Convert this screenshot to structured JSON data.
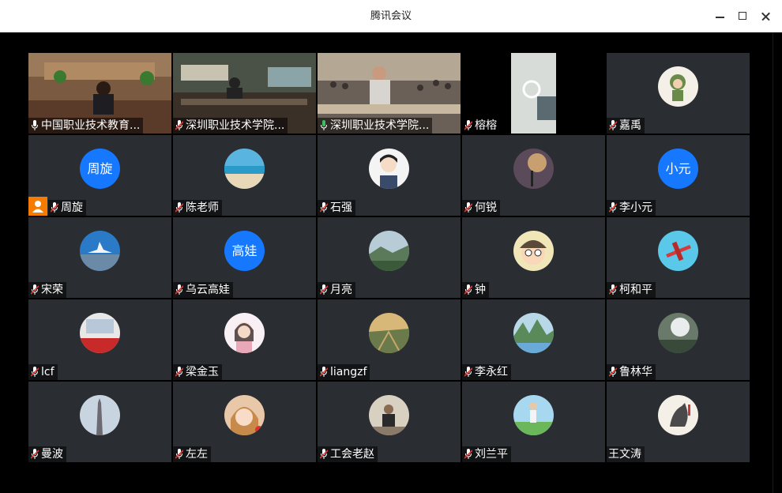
{
  "window": {
    "title": "腾讯会议"
  },
  "colors": {
    "accent": "#1677ff",
    "tile_bg": "#2a2d32",
    "active_border": "#3bbf5c",
    "host_badge": "#f57c00"
  },
  "participants": [
    {
      "name": "中国职业技术教育...",
      "mic": "on-white"
    },
    {
      "name": "深圳职业技术学院...",
      "mic": "muted"
    },
    {
      "name": "深圳职业技术学院...",
      "mic": "speaking"
    },
    {
      "name": "榕榕",
      "mic": "muted"
    },
    {
      "name": "嘉禹",
      "mic": "muted"
    },
    {
      "name": "周旋",
      "avatar_text": "周旋",
      "mic": "muted",
      "host": true
    },
    {
      "name": "陈老师",
      "mic": "muted"
    },
    {
      "name": "石强",
      "mic": "muted"
    },
    {
      "name": "何锐",
      "mic": "muted"
    },
    {
      "name": "李小元",
      "avatar_text": "小元",
      "mic": "muted"
    },
    {
      "name": "宋荣",
      "mic": "muted"
    },
    {
      "name": "乌云高娃",
      "avatar_text": "高娃",
      "mic": "muted"
    },
    {
      "name": "月亮",
      "mic": "muted"
    },
    {
      "name": "钟",
      "mic": "muted"
    },
    {
      "name": "柯和平",
      "mic": "muted"
    },
    {
      "name": "lcf",
      "mic": "muted"
    },
    {
      "name": "梁金玉",
      "mic": "muted"
    },
    {
      "name": "liangzf",
      "mic": "muted"
    },
    {
      "name": "李永红",
      "mic": "muted"
    },
    {
      "name": "鲁林华",
      "mic": "muted"
    },
    {
      "name": "曼波",
      "mic": "muted"
    },
    {
      "name": "左左",
      "mic": "muted"
    },
    {
      "name": "工会老赵",
      "mic": "muted"
    },
    {
      "name": "刘兰平",
      "mic": "muted"
    },
    {
      "name": "王文涛",
      "mic": "none"
    }
  ]
}
